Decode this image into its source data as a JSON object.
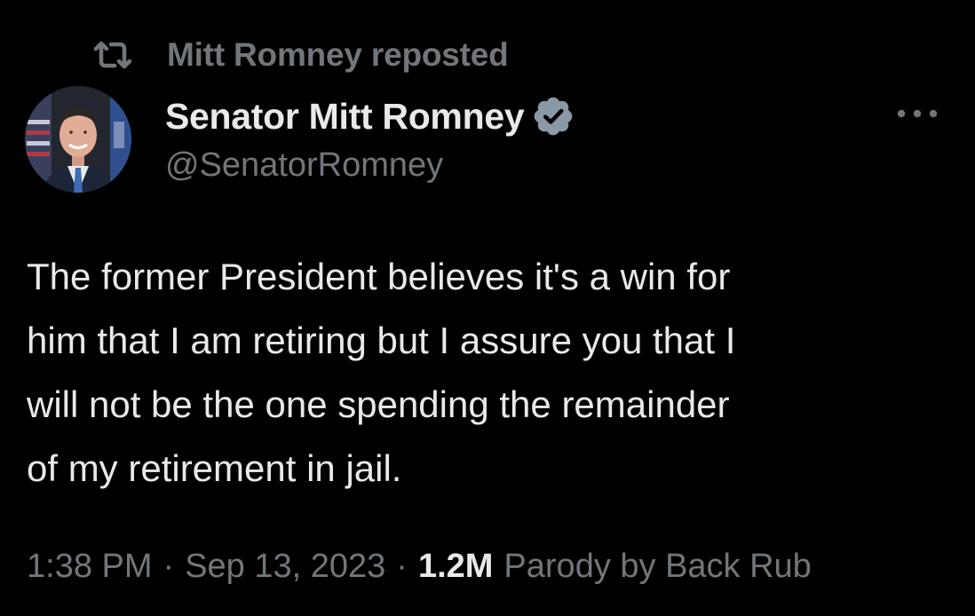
{
  "repost": {
    "text": "Mitt Romney reposted",
    "icon": "repost-icon"
  },
  "author": {
    "display_name": "Senator Mitt Romney",
    "handle": "@SenatorRomney",
    "verified_icon": "verified-badge-icon",
    "verified_color": "#8b98a5"
  },
  "tweet": {
    "lines": [
      "The former President believes it's a win for",
      "him that I am retiring but I assure you that I",
      "will not be the one spending the remainder",
      "of my retirement in jail."
    ]
  },
  "meta": {
    "time": "1:38 PM",
    "separator": "·",
    "date": "Sep 13, 2023",
    "views_count": "1.2M",
    "views_label": "Parody by Back Rub"
  },
  "colors": {
    "background": "#000000",
    "primary_text": "#e7e9ea",
    "secondary_text": "#71767b"
  }
}
